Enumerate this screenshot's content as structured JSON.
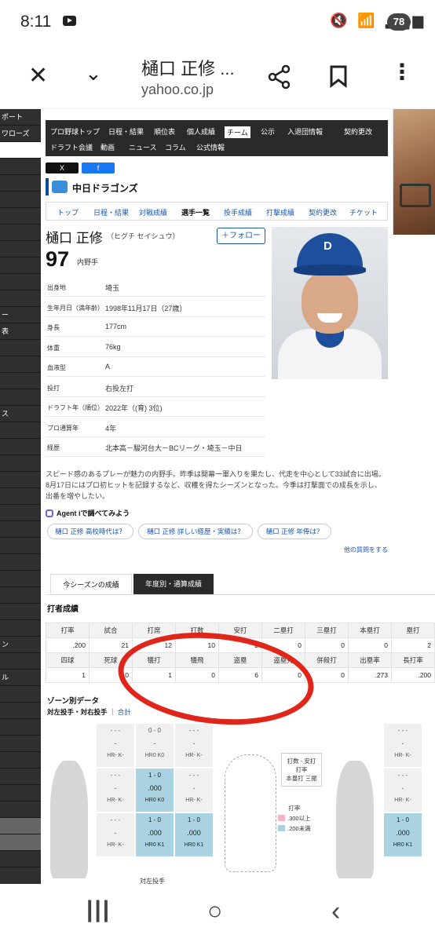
{
  "status": {
    "time": "8:11",
    "battery": "78"
  },
  "browser": {
    "title": "樋口 正修 ...",
    "url": "yahoo.co.jp"
  },
  "leftnav": {
    "items": [
      "ポート",
      "ワローズ",
      "",
      "",
      "",
      "",
      "",
      "",
      "",
      "",
      "",
      "",
      "ー",
      "表",
      "",
      "",
      "",
      "",
      "ス",
      "",
      "",
      "",
      "",
      "",
      "",
      "",
      "",
      "",
      "",
      "",
      "",
      "",
      "ン",
      "",
      "ル",
      "",
      "",
      "",
      "",
      "",
      "",
      "",
      "",
      "",
      "",
      ""
    ]
  },
  "topnav": {
    "row1": [
      "プロ野球トップ",
      "日程・結果",
      "順位表",
      "個人成績",
      "チーム",
      "公示",
      "入退団情報",
      "契約更改"
    ],
    "row2": [
      "ドラフト会議",
      "動画",
      "ニュース",
      "コラム",
      "公式情報"
    ],
    "selected": "チーム"
  },
  "share": {
    "x": "X",
    "fb": "f"
  },
  "team": {
    "name": "中日ドラゴンズ"
  },
  "subnav": [
    "トップ",
    "日程・結果",
    "対戦成績",
    "選手一覧",
    "投手成績",
    "打撃成績",
    "契約更改",
    "チケット"
  ],
  "player": {
    "name": "樋口 正修",
    "kana": "（ヒグチ セイシュウ）",
    "number": "97",
    "position": "内野手",
    "follow": "＋フォロー"
  },
  "profile": [
    {
      "k": "出身地",
      "v": "埼玉"
    },
    {
      "k": "生年月日（満年齢）",
      "v": "1998年11月17日（27歳）"
    },
    {
      "k": "身長",
      "v": "177cm"
    },
    {
      "k": "体重",
      "v": "76kg"
    },
    {
      "k": "血液型",
      "v": "A"
    },
    {
      "k": "投打",
      "v": "右投左打"
    },
    {
      "k": "ドラフト年（順位）",
      "v": "2022年（(育) 3位)"
    },
    {
      "k": "プロ通算年",
      "v": "4年"
    },
    {
      "k": "経歴",
      "v": "北本高－駿河台大－BCリーグ・埼玉－中日"
    }
  ],
  "description": "スピード感のあるプレーが魅力の内野手。昨季は開幕一軍入りを果たし、代走を中心として33試合に出場。8月17日にはプロ初ヒットを記録するなど、収穫を得たシーズンとなった。今季は打撃面での成長を示し、出番を増やしたい。",
  "agent": {
    "label": "Agent iで調べてみよう",
    "chips": [
      "樋口 正修 高校時代は？",
      "樋口 正修 詳しい経歴・実績は？",
      "樋口 正修 年俸は？"
    ],
    "more": "他の質問をする"
  },
  "tabs": {
    "tab1": "今シーズンの成績",
    "tab2": "年度別・通算成績"
  },
  "batting": {
    "title": "打者成績",
    "header1": [
      "打率",
      "試合",
      "打席",
      "打数",
      "安打",
      "二塁打",
      "三塁打",
      "本塁打",
      "塁打"
    ],
    "row1": [
      ".200",
      "21",
      "12",
      "10",
      "2",
      "0",
      "0",
      "0",
      "2"
    ],
    "header2": [
      "四球",
      "死球",
      "犠打",
      "犠飛",
      "盗塁",
      "盗塁死",
      "併殺打",
      "出塁率",
      "長打率"
    ],
    "row2": [
      "1",
      "0",
      "1",
      "0",
      "6",
      "0",
      "0",
      ".273",
      ".200"
    ]
  },
  "zone": {
    "title": "ゾーン別データ",
    "sub": "対左投手・対右投手",
    "sub_link": "合計",
    "left_cells": [
      {
        "l1": "- - -",
        "l2": "-",
        "l3": "HR- K-",
        "c": "g"
      },
      {
        "l1": "0 - 0",
        "l2": "-",
        "l3": "HR0 K0",
        "c": "g"
      },
      {
        "l1": "- - -",
        "l2": "-",
        "l3": "HR- K-",
        "c": "g"
      },
      {
        "l1": "- - -",
        "l2": "-",
        "l3": "HR- K-",
        "c": "g"
      },
      {
        "l1": "1 - 0",
        "l2": ".000",
        "l3": "HR0 K0",
        "c": "b"
      },
      {
        "l1": "- - -",
        "l2": "-",
        "l3": "HR- K-",
        "c": "g"
      },
      {
        "l1": "- - -",
        "l2": "-",
        "l3": "HR- K-",
        "c": "g"
      },
      {
        "l1": "1 - 0",
        "l2": ".000",
        "l3": "HR0 K1",
        "c": "b"
      },
      {
        "l1": "1 - 0",
        "l2": ".000",
        "l3": "HR0 K1",
        "c": "b"
      }
    ],
    "right_cells": [
      {
        "l1": "- - -",
        "l2": "-",
        "l3": "HR- K-",
        "c": "g"
      },
      {
        "l1": "- - -",
        "l2": "-",
        "l3": "HR- K-",
        "c": "g"
      },
      {
        "l1": "1 - 0",
        "l2": ".000",
        "l3": "HR0 K1",
        "c": "b"
      }
    ],
    "legend": [
      "打数 - 安打",
      "打率",
      "本塁打 三振"
    ],
    "legend2": {
      "title": "打率",
      "pink": ".300以上",
      "blue": ".200未満"
    },
    "footer": "対左投手"
  },
  "colors": {
    "nav_dark": "#2a2a2a",
    "link": "#1a55b0",
    "zone_blue": "#a9d3e3",
    "annot_red": "#e0251b"
  }
}
